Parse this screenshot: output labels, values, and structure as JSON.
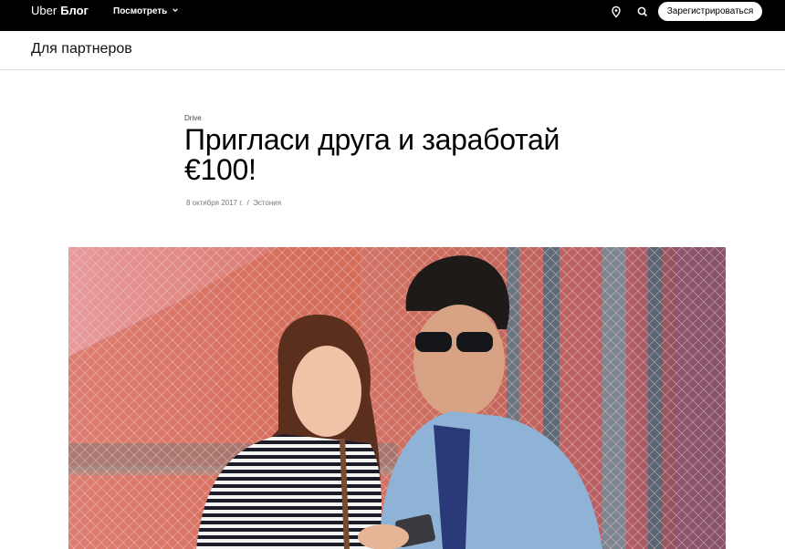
{
  "header": {
    "brand_uber": "Uber",
    "brand_blog": "Блог",
    "view_menu_label": "Посмотреть",
    "signup_label": "Зарегистрироваться",
    "icons": [
      "location-pin-icon",
      "search-icon",
      "chevron-down-icon"
    ]
  },
  "subheader": {
    "title": "Для партнеров"
  },
  "article": {
    "category": "Drive",
    "title": "Пригласи друга и заработай €100!",
    "date": "8 октября 2017 г.",
    "separator": "/",
    "location": "Эстония"
  },
  "colors": {
    "topbar_bg": "#000000",
    "text": "#000000",
    "meta_text": "#777777"
  }
}
